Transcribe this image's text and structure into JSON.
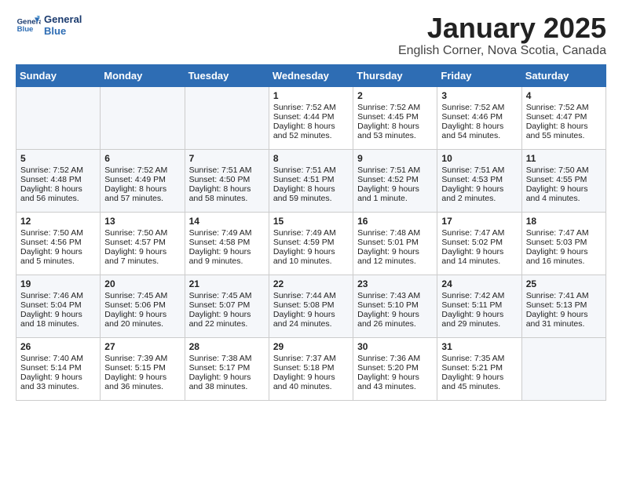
{
  "header": {
    "logo_line1": "General",
    "logo_line2": "Blue",
    "title": "January 2025",
    "subtitle": "English Corner, Nova Scotia, Canada"
  },
  "weekdays": [
    "Sunday",
    "Monday",
    "Tuesday",
    "Wednesday",
    "Thursday",
    "Friday",
    "Saturday"
  ],
  "weeks": [
    [
      {
        "day": "",
        "content": ""
      },
      {
        "day": "",
        "content": ""
      },
      {
        "day": "",
        "content": ""
      },
      {
        "day": "1",
        "content": "Sunrise: 7:52 AM\nSunset: 4:44 PM\nDaylight: 8 hours and 52 minutes."
      },
      {
        "day": "2",
        "content": "Sunrise: 7:52 AM\nSunset: 4:45 PM\nDaylight: 8 hours and 53 minutes."
      },
      {
        "day": "3",
        "content": "Sunrise: 7:52 AM\nSunset: 4:46 PM\nDaylight: 8 hours and 54 minutes."
      },
      {
        "day": "4",
        "content": "Sunrise: 7:52 AM\nSunset: 4:47 PM\nDaylight: 8 hours and 55 minutes."
      }
    ],
    [
      {
        "day": "5",
        "content": "Sunrise: 7:52 AM\nSunset: 4:48 PM\nDaylight: 8 hours and 56 minutes."
      },
      {
        "day": "6",
        "content": "Sunrise: 7:52 AM\nSunset: 4:49 PM\nDaylight: 8 hours and 57 minutes."
      },
      {
        "day": "7",
        "content": "Sunrise: 7:51 AM\nSunset: 4:50 PM\nDaylight: 8 hours and 58 minutes."
      },
      {
        "day": "8",
        "content": "Sunrise: 7:51 AM\nSunset: 4:51 PM\nDaylight: 8 hours and 59 minutes."
      },
      {
        "day": "9",
        "content": "Sunrise: 7:51 AM\nSunset: 4:52 PM\nDaylight: 9 hours and 1 minute."
      },
      {
        "day": "10",
        "content": "Sunrise: 7:51 AM\nSunset: 4:53 PM\nDaylight: 9 hours and 2 minutes."
      },
      {
        "day": "11",
        "content": "Sunrise: 7:50 AM\nSunset: 4:55 PM\nDaylight: 9 hours and 4 minutes."
      }
    ],
    [
      {
        "day": "12",
        "content": "Sunrise: 7:50 AM\nSunset: 4:56 PM\nDaylight: 9 hours and 5 minutes."
      },
      {
        "day": "13",
        "content": "Sunrise: 7:50 AM\nSunset: 4:57 PM\nDaylight: 9 hours and 7 minutes."
      },
      {
        "day": "14",
        "content": "Sunrise: 7:49 AM\nSunset: 4:58 PM\nDaylight: 9 hours and 9 minutes."
      },
      {
        "day": "15",
        "content": "Sunrise: 7:49 AM\nSunset: 4:59 PM\nDaylight: 9 hours and 10 minutes."
      },
      {
        "day": "16",
        "content": "Sunrise: 7:48 AM\nSunset: 5:01 PM\nDaylight: 9 hours and 12 minutes."
      },
      {
        "day": "17",
        "content": "Sunrise: 7:47 AM\nSunset: 5:02 PM\nDaylight: 9 hours and 14 minutes."
      },
      {
        "day": "18",
        "content": "Sunrise: 7:47 AM\nSunset: 5:03 PM\nDaylight: 9 hours and 16 minutes."
      }
    ],
    [
      {
        "day": "19",
        "content": "Sunrise: 7:46 AM\nSunset: 5:04 PM\nDaylight: 9 hours and 18 minutes."
      },
      {
        "day": "20",
        "content": "Sunrise: 7:45 AM\nSunset: 5:06 PM\nDaylight: 9 hours and 20 minutes."
      },
      {
        "day": "21",
        "content": "Sunrise: 7:45 AM\nSunset: 5:07 PM\nDaylight: 9 hours and 22 minutes."
      },
      {
        "day": "22",
        "content": "Sunrise: 7:44 AM\nSunset: 5:08 PM\nDaylight: 9 hours and 24 minutes."
      },
      {
        "day": "23",
        "content": "Sunrise: 7:43 AM\nSunset: 5:10 PM\nDaylight: 9 hours and 26 minutes."
      },
      {
        "day": "24",
        "content": "Sunrise: 7:42 AM\nSunset: 5:11 PM\nDaylight: 9 hours and 29 minutes."
      },
      {
        "day": "25",
        "content": "Sunrise: 7:41 AM\nSunset: 5:13 PM\nDaylight: 9 hours and 31 minutes."
      }
    ],
    [
      {
        "day": "26",
        "content": "Sunrise: 7:40 AM\nSunset: 5:14 PM\nDaylight: 9 hours and 33 minutes."
      },
      {
        "day": "27",
        "content": "Sunrise: 7:39 AM\nSunset: 5:15 PM\nDaylight: 9 hours and 36 minutes."
      },
      {
        "day": "28",
        "content": "Sunrise: 7:38 AM\nSunset: 5:17 PM\nDaylight: 9 hours and 38 minutes."
      },
      {
        "day": "29",
        "content": "Sunrise: 7:37 AM\nSunset: 5:18 PM\nDaylight: 9 hours and 40 minutes."
      },
      {
        "day": "30",
        "content": "Sunrise: 7:36 AM\nSunset: 5:20 PM\nDaylight: 9 hours and 43 minutes."
      },
      {
        "day": "31",
        "content": "Sunrise: 7:35 AM\nSunset: 5:21 PM\nDaylight: 9 hours and 45 minutes."
      },
      {
        "day": "",
        "content": ""
      }
    ]
  ]
}
